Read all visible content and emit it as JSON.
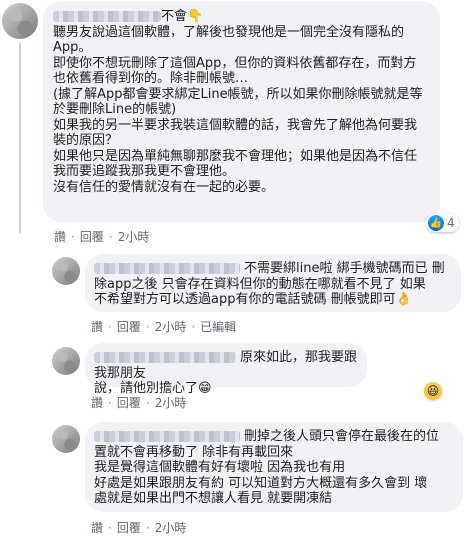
{
  "comments": [
    {
      "name_suffix": "不會👇",
      "lines": [
        "聽男友說過這個軟體，了解後也發現他是一個完全沒有隱私的",
        "App。",
        "即使你不想玩刪除了這個App，但你的資料依舊都存在，而對方",
        "也依舊看得到你的。除非刪帳號…",
        "(據了解App都會要求綁定Line帳號，所以如果你刪除帳號就是等",
        "於要刪除Line的帳號)",
        "如果我的另一半要求我裝這個軟體的話，我會先了解他為何要我",
        "裝的原因？",
        "如果他只是因為單純無聊那麼我不會理他；如果他是因為不信任",
        "我而要追蹤我那我更不會理他。",
        "沒有信任的愛情就沒有在一起的必要。"
      ],
      "reaction_count": "4",
      "actions": [
        "讚",
        "回覆",
        "2小時"
      ]
    },
    {
      "lines": [
        "不需要綁line啦 綁手機號碼而已 刪",
        "除app之後 只會存在資料但你的動態在哪就看不見了 如果",
        "不希望對方可以透過app有你的電話號碼 刪帳號即可👌"
      ],
      "actions": [
        "讚",
        "回覆",
        "2小時",
        "已編輯"
      ]
    },
    {
      "lines": [
        "原來如此，那我要跟我那朋友",
        "說，請他別擔心了😁"
      ],
      "actions": [
        "讚",
        "回覆",
        "2小時"
      ]
    },
    {
      "lines": [
        "刪掉之後人頭只會停在最後在的位",
        "置就不會再移動了 除非有再載回來",
        "我是覺得這個軟體有好有壞啦 因為我也有用",
        "好處是如果跟朋友有約 可以知道對方大概還有多久會到 壞",
        "處就是如果出門不想讓人看見 就要開凍結"
      ],
      "actions": [
        "讚",
        "回覆",
        "2小時"
      ]
    }
  ],
  "icons": {
    "like": "like-icon",
    "haha": "haha-icon"
  }
}
